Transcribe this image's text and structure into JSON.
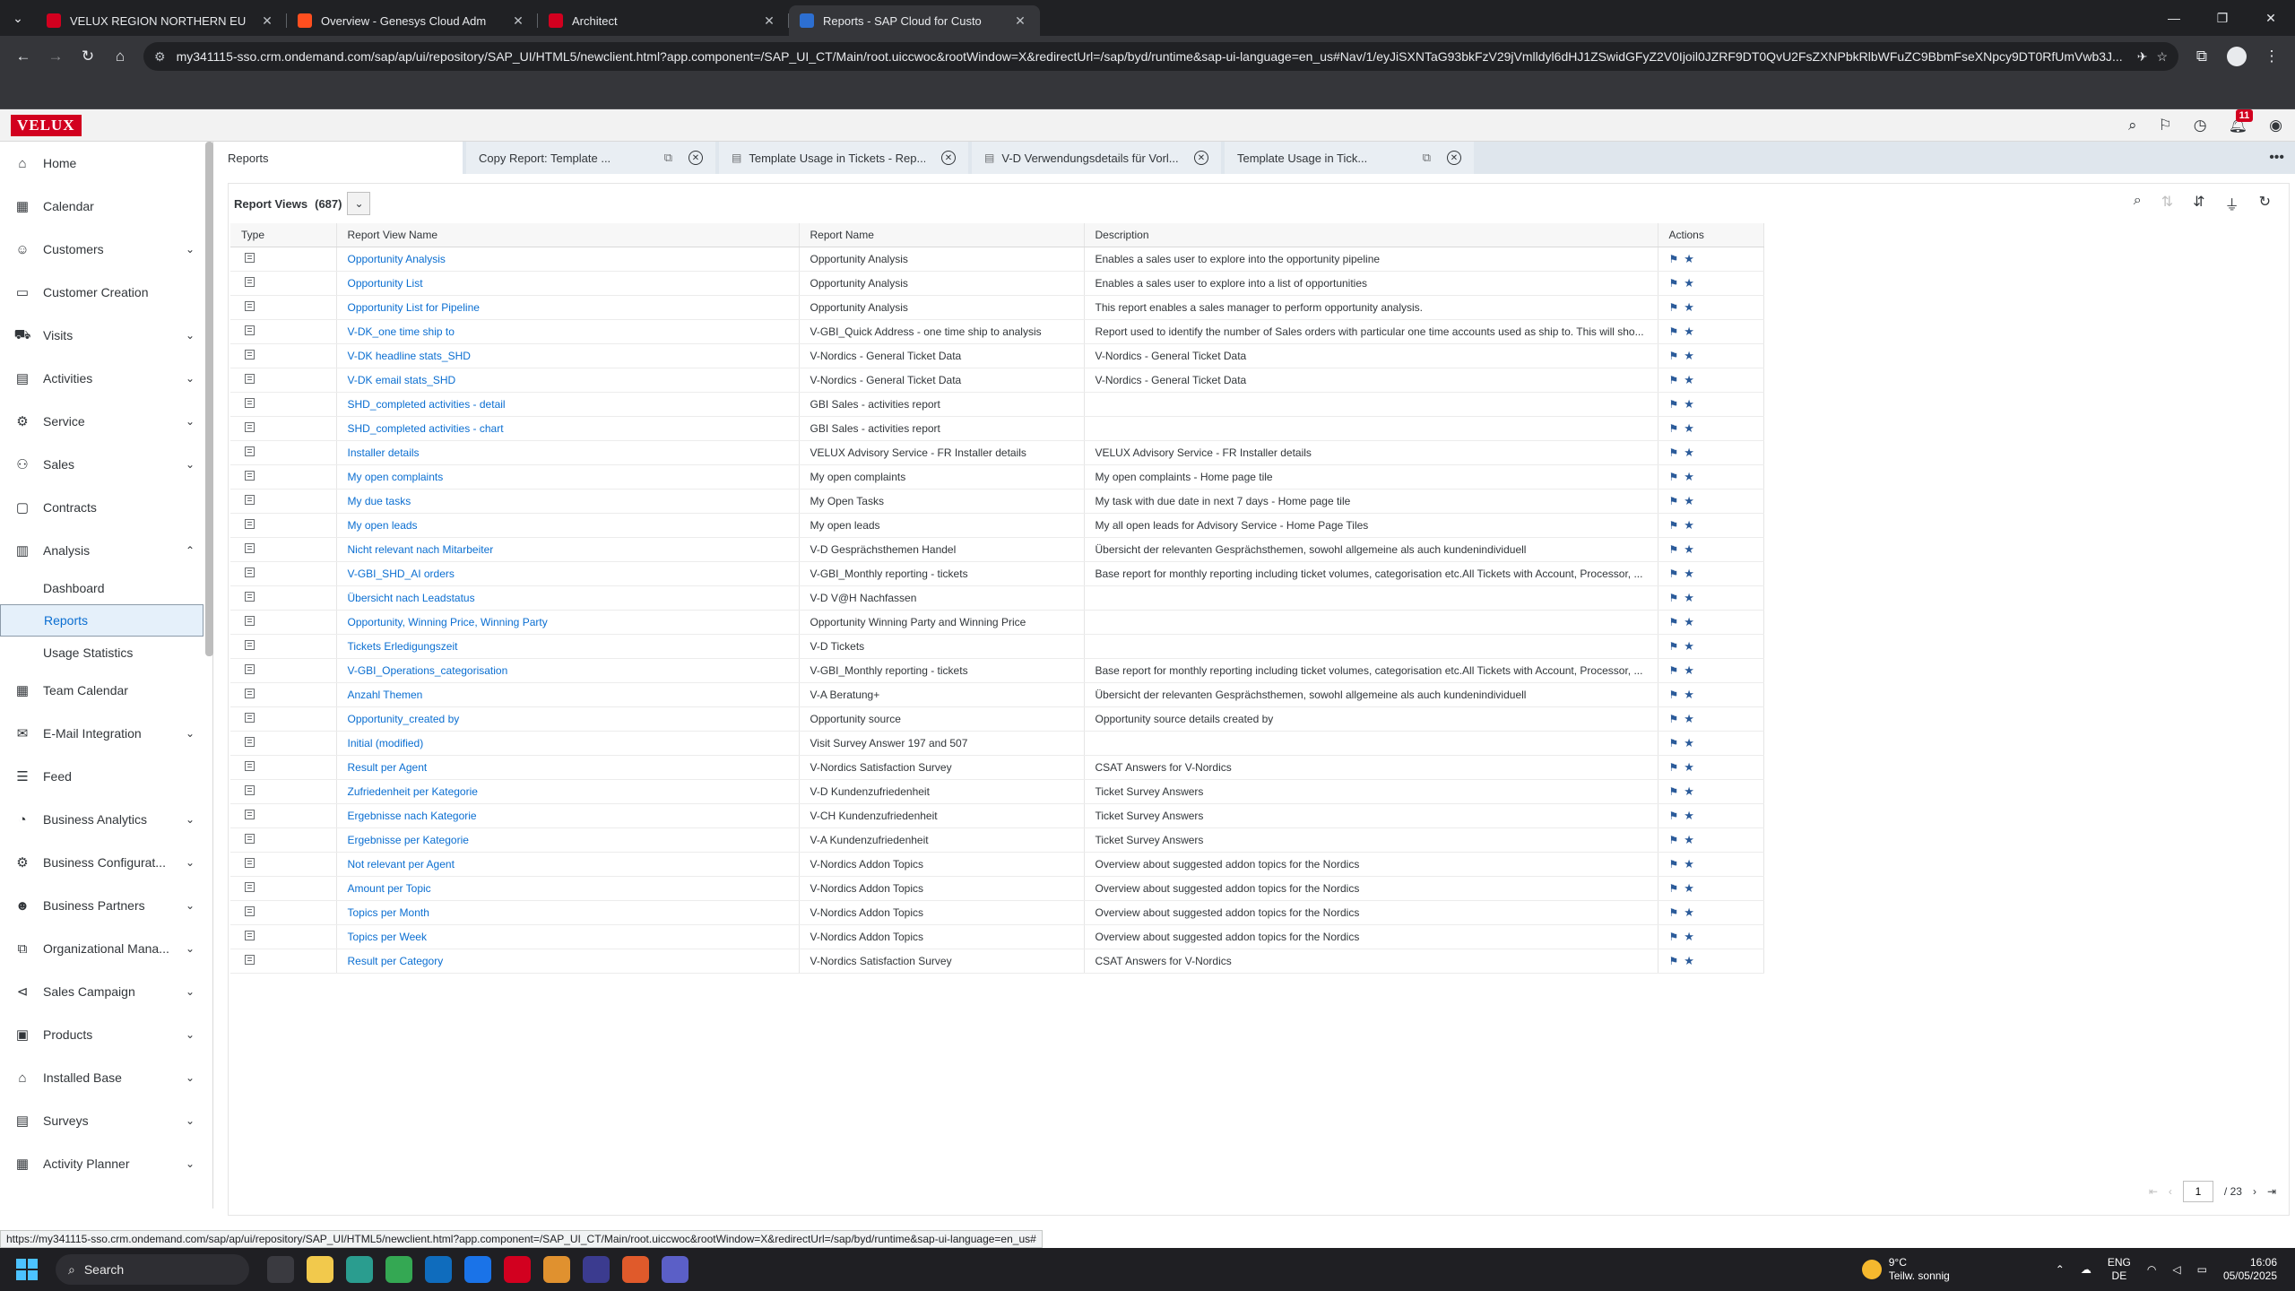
{
  "browser": {
    "tabs": [
      {
        "title": "VELUX REGION NORTHERN EU",
        "color": "#d2001f",
        "active": false
      },
      {
        "title": "Overview - Genesys Cloud Adm",
        "color": "#ff4f1f",
        "active": false
      },
      {
        "title": "Architect",
        "color": "#d2001f",
        "active": false
      },
      {
        "title": "Reports - SAP Cloud for Custo",
        "color": "#2d6fd1",
        "active": true
      }
    ],
    "url": "my341115-sso.crm.ondemand.com/sap/ap/ui/repository/SAP_UI/HTML5/newclient.html?app.component=/SAP_UI_CT/Main/root.uiccwoc&rootWindow=X&redirectUrl=/sap/byd/runtime&sap-ui-language=en_us#Nav/1/eyJiSXNTaG93bkFzV29jVmlldyl6dHJ1ZSwidGFyZ2V0Ijoil0JZRF9DT0QvU2FsZXNPbkRlbWFuZC9BbmFseXNpcy9DT0RfUmVwb3J...",
    "status_url": "https://my341115-sso.crm.ondemand.com/sap/ap/ui/repository/SAP_UI/HTML5/newclient.html?app.component=/SAP_UI_CT/Main/root.uiccwoc&rootWindow=X&redirectUrl=/sap/byd/runtime&sap-ui-language=en_us#"
  },
  "shell": {
    "logo": "VELUX",
    "notification_count": "11"
  },
  "sidebar": {
    "items": [
      {
        "label": "Home",
        "icon": "home-icon",
        "glyph": "⌂",
        "chevron": ""
      },
      {
        "label": "Calendar",
        "icon": "calendar-icon",
        "glyph": "▦",
        "chevron": ""
      },
      {
        "label": "Customers",
        "icon": "customers-icon",
        "glyph": "☺",
        "chevron": "⌄"
      },
      {
        "label": "Customer Creation",
        "icon": "customer-creation-icon",
        "glyph": "▭",
        "chevron": ""
      },
      {
        "label": "Visits",
        "icon": "visits-icon",
        "glyph": "⛟",
        "chevron": "⌄"
      },
      {
        "label": "Activities",
        "icon": "activities-icon",
        "glyph": "▤",
        "chevron": "⌄"
      },
      {
        "label": "Service",
        "icon": "service-icon",
        "glyph": "⚙",
        "chevron": "⌄"
      },
      {
        "label": "Sales",
        "icon": "sales-icon",
        "glyph": "⚇",
        "chevron": "⌄"
      },
      {
        "label": "Contracts",
        "icon": "contracts-icon",
        "glyph": "▢",
        "chevron": ""
      },
      {
        "label": "Analysis",
        "icon": "analysis-icon",
        "glyph": "▥",
        "chevron": "⌃"
      }
    ],
    "sub_items": [
      {
        "label": "Dashboard",
        "selected": false
      },
      {
        "label": "Reports",
        "selected": true
      },
      {
        "label": "Usage Statistics",
        "selected": false
      }
    ],
    "items_after": [
      {
        "label": "Team Calendar",
        "icon": "team-calendar-icon",
        "glyph": "▦",
        "chevron": ""
      },
      {
        "label": "E-Mail Integration",
        "icon": "email-icon",
        "glyph": "✉",
        "chevron": "⌄"
      },
      {
        "label": "Feed",
        "icon": "feed-icon",
        "glyph": "☰",
        "chevron": ""
      },
      {
        "label": "Business Analytics",
        "icon": "business-analytics-icon",
        "glyph": "◔",
        "chevron": "⌄"
      },
      {
        "label": "Business Configurat...",
        "icon": "business-config-icon",
        "glyph": "⚙",
        "chevron": "⌄"
      },
      {
        "label": "Business Partners",
        "icon": "business-partners-icon",
        "glyph": "☻",
        "chevron": "⌄"
      },
      {
        "label": "Organizational Mana...",
        "icon": "org-management-icon",
        "glyph": "⧉",
        "chevron": "⌄"
      },
      {
        "label": "Sales Campaign",
        "icon": "sales-campaign-icon",
        "glyph": "⊲",
        "chevron": "⌄"
      },
      {
        "label": "Products",
        "icon": "products-icon",
        "glyph": "▣",
        "chevron": "⌄"
      },
      {
        "label": "Installed Base",
        "icon": "installed-base-icon",
        "glyph": "⌂",
        "chevron": "⌄"
      },
      {
        "label": "Surveys",
        "icon": "surveys-icon",
        "glyph": "▤",
        "chevron": "⌄"
      },
      {
        "label": "Activity Planner",
        "icon": "activity-planner-icon",
        "glyph": "▦",
        "chevron": "⌄"
      }
    ]
  },
  "content_tabs": [
    {
      "label": "Reports",
      "active": true,
      "popout": false,
      "closable": false,
      "doc": false,
      "width": 276
    },
    {
      "label": "Copy Report: Template ...",
      "active": false,
      "popout": true,
      "closable": true,
      "doc": false,
      "width": 278
    },
    {
      "label": "Template Usage in Tickets - Rep...",
      "active": false,
      "popout": false,
      "closable": true,
      "doc": true,
      "width": 278
    },
    {
      "label": "V-D Verwendungsdetails für Vorl...",
      "active": false,
      "popout": false,
      "closable": true,
      "doc": true,
      "width": 278
    },
    {
      "label": "Template Usage in Tick...",
      "active": false,
      "popout": true,
      "closable": true,
      "doc": false,
      "width": 278
    }
  ],
  "report_views": {
    "title": "Report Views",
    "count": "(687)",
    "columns": [
      "Type",
      "Report View Name",
      "Report Name",
      "Description",
      "Actions"
    ],
    "rows": [
      [
        "Opportunity Analysis",
        "Opportunity Analysis",
        "Enables a sales user to explore into the opportunity pipeline"
      ],
      [
        "Opportunity List",
        "Opportunity Analysis",
        "Enables a sales user to explore into a list of opportunities"
      ],
      [
        "Opportunity List for Pipeline",
        "Opportunity Analysis",
        "This report enables a sales manager to perform opportunity analysis."
      ],
      [
        "V-DK_one time ship to",
        "V-GBI_Quick Address - one time ship to analysis",
        "Report used to identify the number of Sales orders with particular one time accounts used as ship to. This will sho..."
      ],
      [
        "V-DK headline stats_SHD",
        "V-Nordics - General Ticket Data",
        "V-Nordics - General Ticket Data"
      ],
      [
        "V-DK email stats_SHD",
        "V-Nordics - General Ticket Data",
        "V-Nordics - General Ticket Data"
      ],
      [
        "SHD_completed activities - detail",
        "GBI Sales - activities report",
        ""
      ],
      [
        "SHD_completed activities - chart",
        "GBI Sales - activities report",
        ""
      ],
      [
        "Installer details",
        "VELUX Advisory Service - FR Installer details",
        "VELUX Advisory Service - FR Installer details"
      ],
      [
        "My open complaints",
        "My open complaints",
        "My open complaints - Home page tile"
      ],
      [
        "My due tasks",
        "My Open Tasks",
        "My task with due date in next 7 days - Home page tile"
      ],
      [
        "My open leads",
        "My open leads",
        "My all open leads for Advisory Service - Home Page Tiles"
      ],
      [
        "Nicht relevant nach Mitarbeiter",
        "V-D Gesprächsthemen Handel",
        "Übersicht der relevanten Gesprächsthemen, sowohl allgemeine als auch kundenindividuell"
      ],
      [
        "V-GBI_SHD_AI orders",
        "V-GBI_Monthly reporting - tickets",
        "Base report for monthly reporting including ticket volumes, categorisation etc.All Tickets with Account, Processor, ..."
      ],
      [
        "Übersicht nach Leadstatus",
        "V-D V@H Nachfassen",
        ""
      ],
      [
        "Opportunity, Winning Price, Winning Party",
        "Opportunity Winning Party and Winning Price",
        ""
      ],
      [
        "Tickets Erledigungszeit",
        "V-D Tickets",
        ""
      ],
      [
        "V-GBI_Operations_categorisation",
        "V-GBI_Monthly reporting - tickets",
        "Base report for monthly reporting including ticket volumes, categorisation etc.All Tickets with Account, Processor, ..."
      ],
      [
        "Anzahl Themen",
        "V-A Beratung+",
        "Übersicht der relevanten Gesprächsthemen, sowohl allgemeine als auch kundenindividuell"
      ],
      [
        "Opportunity_created by",
        "Opportunity source",
        "Opportunity source details created by"
      ],
      [
        "Initial (modified)",
        "Visit Survey Answer 197 and 507",
        ""
      ],
      [
        "Result per Agent",
        "V-Nordics Satisfaction Survey",
        "CSAT Answers for V-Nordics"
      ],
      [
        "Zufriedenheit per Kategorie",
        "V-D Kundenzufriedenheit",
        "Ticket Survey Answers"
      ],
      [
        "Ergebnisse nach Kategorie",
        "V-CH Kundenzufriedenheit",
        "Ticket Survey Answers"
      ],
      [
        "Ergebnisse per Kategorie",
        "V-A Kundenzufriedenheit",
        "Ticket Survey Answers"
      ],
      [
        "Not relevant per Agent",
        "V-Nordics Addon Topics",
        "Overview about suggested addon topics for the Nordics"
      ],
      [
        "Amount per Topic",
        "V-Nordics Addon Topics",
        "Overview about suggested addon topics for the Nordics"
      ],
      [
        "Topics per Month",
        "V-Nordics Addon Topics",
        "Overview about suggested addon topics for the Nordics"
      ],
      [
        "Topics per Week",
        "V-Nordics Addon Topics",
        "Overview about suggested addon topics for the Nordics"
      ],
      [
        "Result per Category",
        "V-Nordics Satisfaction Survey",
        "CSAT Answers for V-Nordics"
      ]
    ]
  },
  "pager": {
    "page": "1",
    "total": "/ 23"
  },
  "taskbar": {
    "search_placeholder": "Search",
    "weather_temp": "9°C",
    "weather_desc": "Teilw. sonnig",
    "lang_top": "ENG",
    "lang_bottom": "DE",
    "time": "16:06",
    "date": "05/05/2025"
  }
}
